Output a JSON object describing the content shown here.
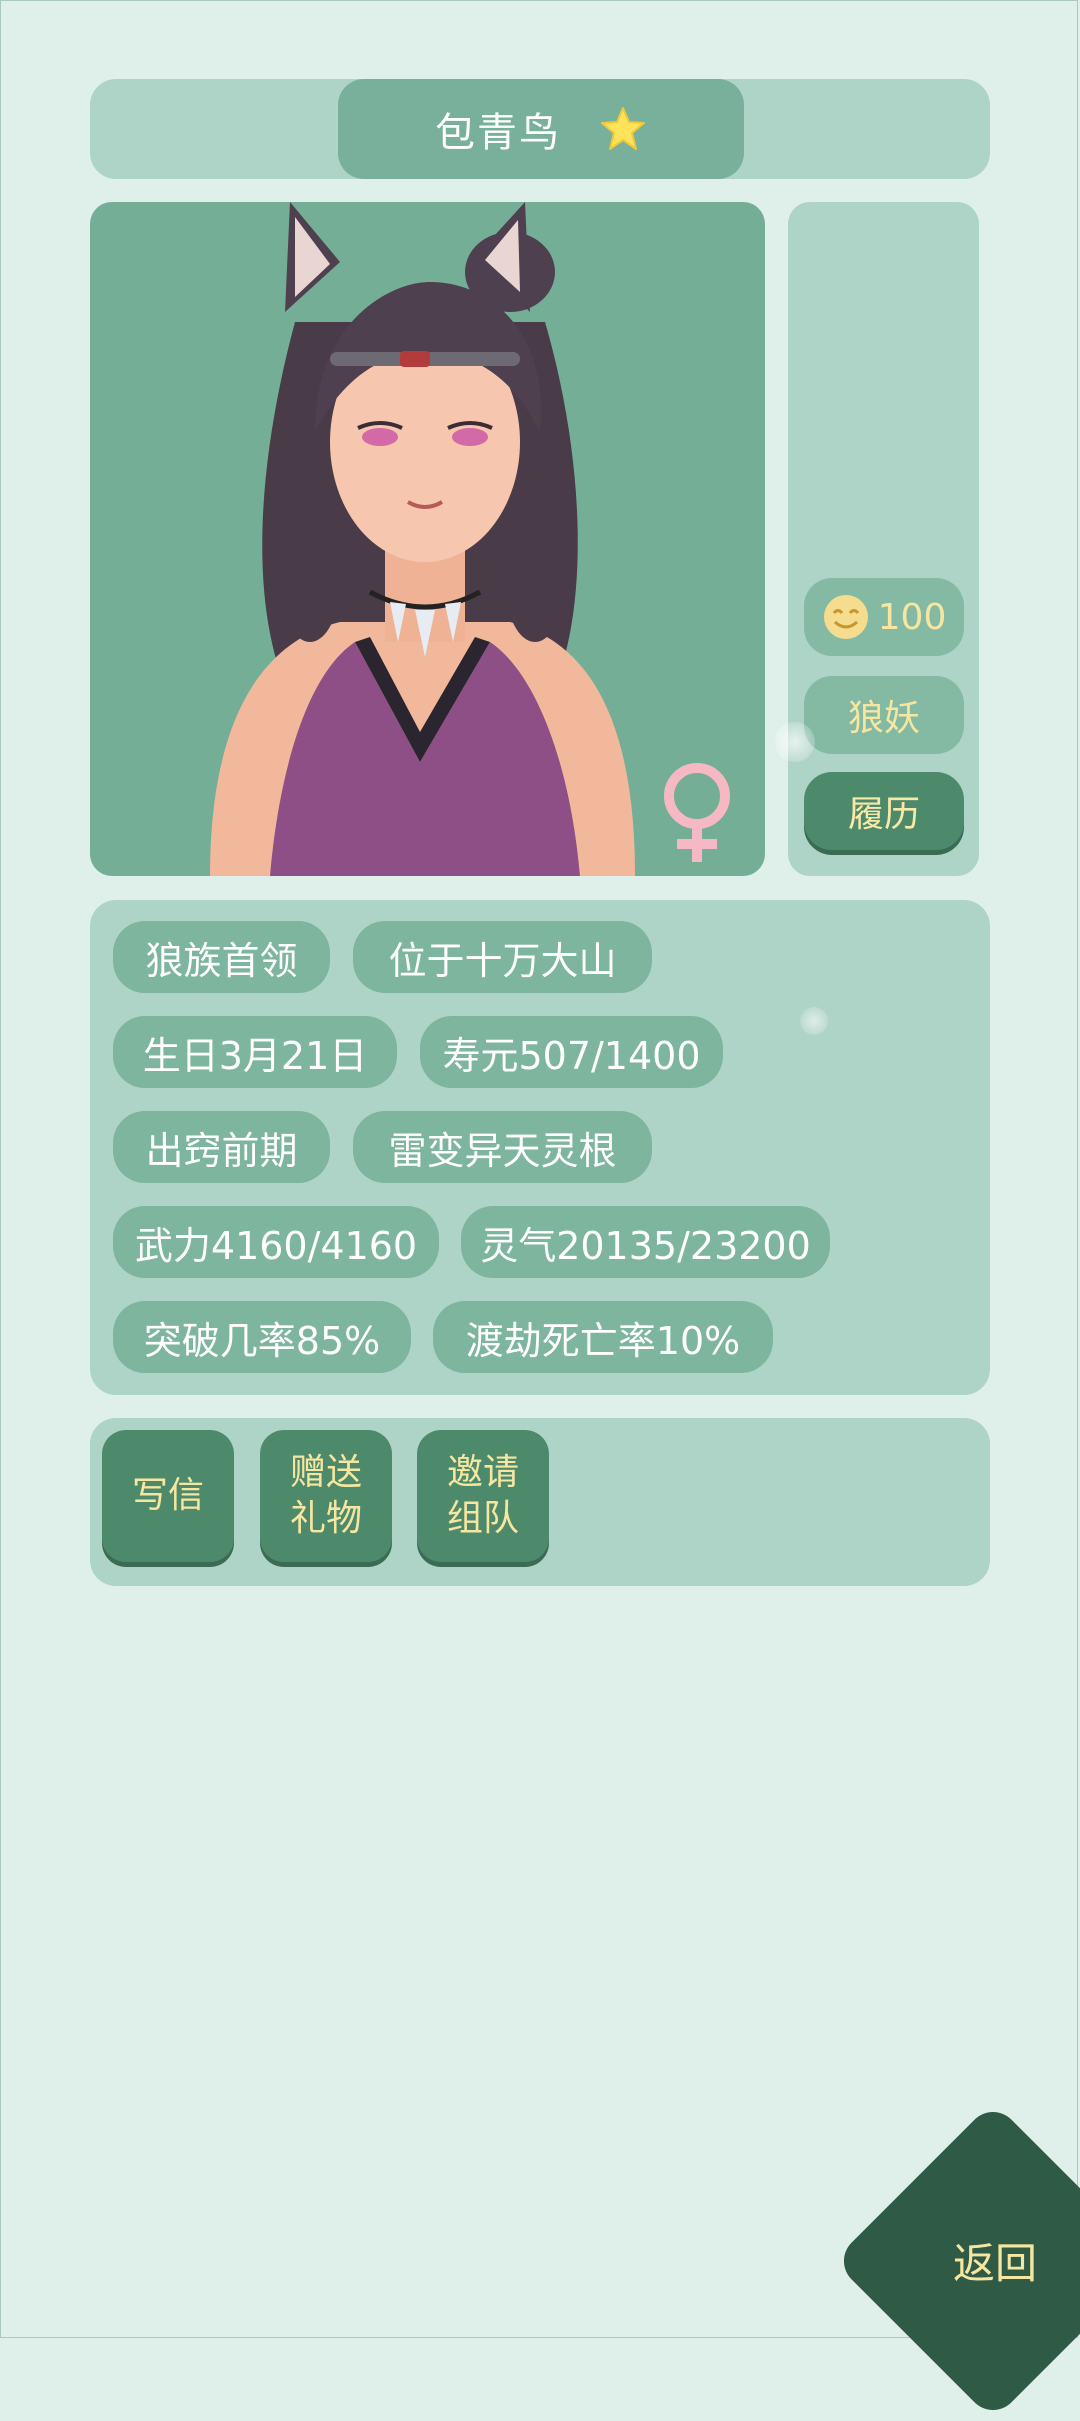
{
  "character": {
    "name": "包青鸟",
    "favorite_icon": "star-icon",
    "gender_icon": "female-symbol-icon",
    "portrait": "wolf-demon-girl-portrait"
  },
  "side_panel": {
    "mood_icon": "smile-icon",
    "favor_value": "100",
    "race_label": "狼妖",
    "history_button": "履历"
  },
  "tags": [
    "狼族首领",
    "位于十万大山",
    "生日3月21日",
    "寿元507/1400",
    "出窍前期",
    "雷变异天灵根",
    "武力4160/4160",
    "灵气20135/23200",
    "突破几率85%",
    "渡劫死亡率10%"
  ],
  "actions": [
    {
      "line1": "写信",
      "line2": ""
    },
    {
      "line1": "赠送",
      "line2": "礼物"
    },
    {
      "line1": "邀请",
      "line2": "组队"
    }
  ],
  "back_label": "返回",
  "colors": {
    "background": "#dff0ea",
    "panel": "#aed3c7",
    "pill": "#7db59e",
    "button": "#4d8a6c",
    "gold_text": "#f6e6a0"
  }
}
